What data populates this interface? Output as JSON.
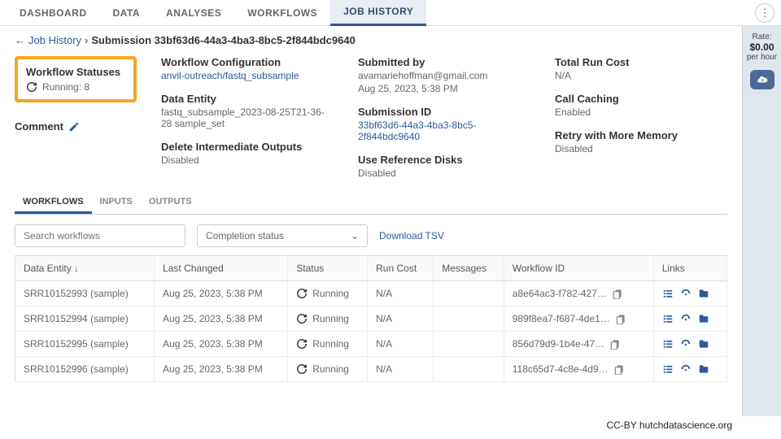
{
  "tabs": {
    "dashboard": "DASHBOARD",
    "data": "DATA",
    "analyses": "ANALYSES",
    "workflows": "WORKFLOWS",
    "job_history": "JOB HISTORY"
  },
  "breadcrumb": {
    "back_arrow": "←",
    "job_history": "Job History",
    "sep": "›",
    "current": "Submission 33bf63d6-44a3-4ba3-8bc5-2f844bdc9640"
  },
  "rate": {
    "label": "Rate:",
    "value": "$0.00",
    "per": "per hour"
  },
  "status_box": {
    "title": "Workflow Statuses",
    "running_label": "Running: 8"
  },
  "comment": {
    "label": "Comment"
  },
  "fields": {
    "config": {
      "label": "Workflow Configuration",
      "value": "anvil-outreach/fastq_subsample"
    },
    "entity": {
      "label": "Data Entity",
      "value": "fastq_subsample_2023-08-25T21-36-28 sample_set"
    },
    "delete": {
      "label": "Delete Intermediate Outputs",
      "value": "Disabled"
    },
    "submitted_by": {
      "label": "Submitted by",
      "value1": "avamariehoffman@gmail.com",
      "value2": "Aug 25, 2023, 5:38 PM"
    },
    "submission_id": {
      "label": "Submission ID",
      "value": "33bf63d6-44a3-4ba3-8bc5-2f844bdc9640"
    },
    "ref_disks": {
      "label": "Use Reference Disks",
      "value": "Disabled"
    },
    "run_cost": {
      "label": "Total Run Cost",
      "value": "N/A"
    },
    "caching": {
      "label": "Call Caching",
      "value": "Enabled"
    },
    "retry": {
      "label": "Retry with More Memory",
      "value": "Disabled"
    }
  },
  "subtabs": {
    "workflows": "WORKFLOWS",
    "inputs": "INPUTS",
    "outputs": "OUTPUTS"
  },
  "controls": {
    "search_placeholder": "Search workflows",
    "completion": "Completion status",
    "download": "Download TSV"
  },
  "table": {
    "headers": {
      "entity": "Data Entity",
      "changed": "Last Changed",
      "status": "Status",
      "cost": "Run Cost",
      "messages": "Messages",
      "wfid": "Workflow ID",
      "links": "Links"
    },
    "rows": [
      {
        "entity": "SRR10152993 (sample)",
        "changed": "Aug 25, 2023, 5:38 PM",
        "status": "Running",
        "cost": "N/A",
        "messages": "",
        "wfid": "a8e64ac3-f782-427…"
      },
      {
        "entity": "SRR10152994 (sample)",
        "changed": "Aug 25, 2023, 5:38 PM",
        "status": "Running",
        "cost": "N/A",
        "messages": "",
        "wfid": "989f8ea7-f687-4de1…"
      },
      {
        "entity": "SRR10152995 (sample)",
        "changed": "Aug 25, 2023, 5:38 PM",
        "status": "Running",
        "cost": "N/A",
        "messages": "",
        "wfid": "856d79d9-1b4e-47…"
      },
      {
        "entity": "SRR10152996 (sample)",
        "changed": "Aug 25, 2023, 5:38 PM",
        "status": "Running",
        "cost": "N/A",
        "messages": "",
        "wfid": "118c65d7-4c8e-4d9…"
      }
    ]
  },
  "footer": "CC-BY  hutchdatascience.org"
}
